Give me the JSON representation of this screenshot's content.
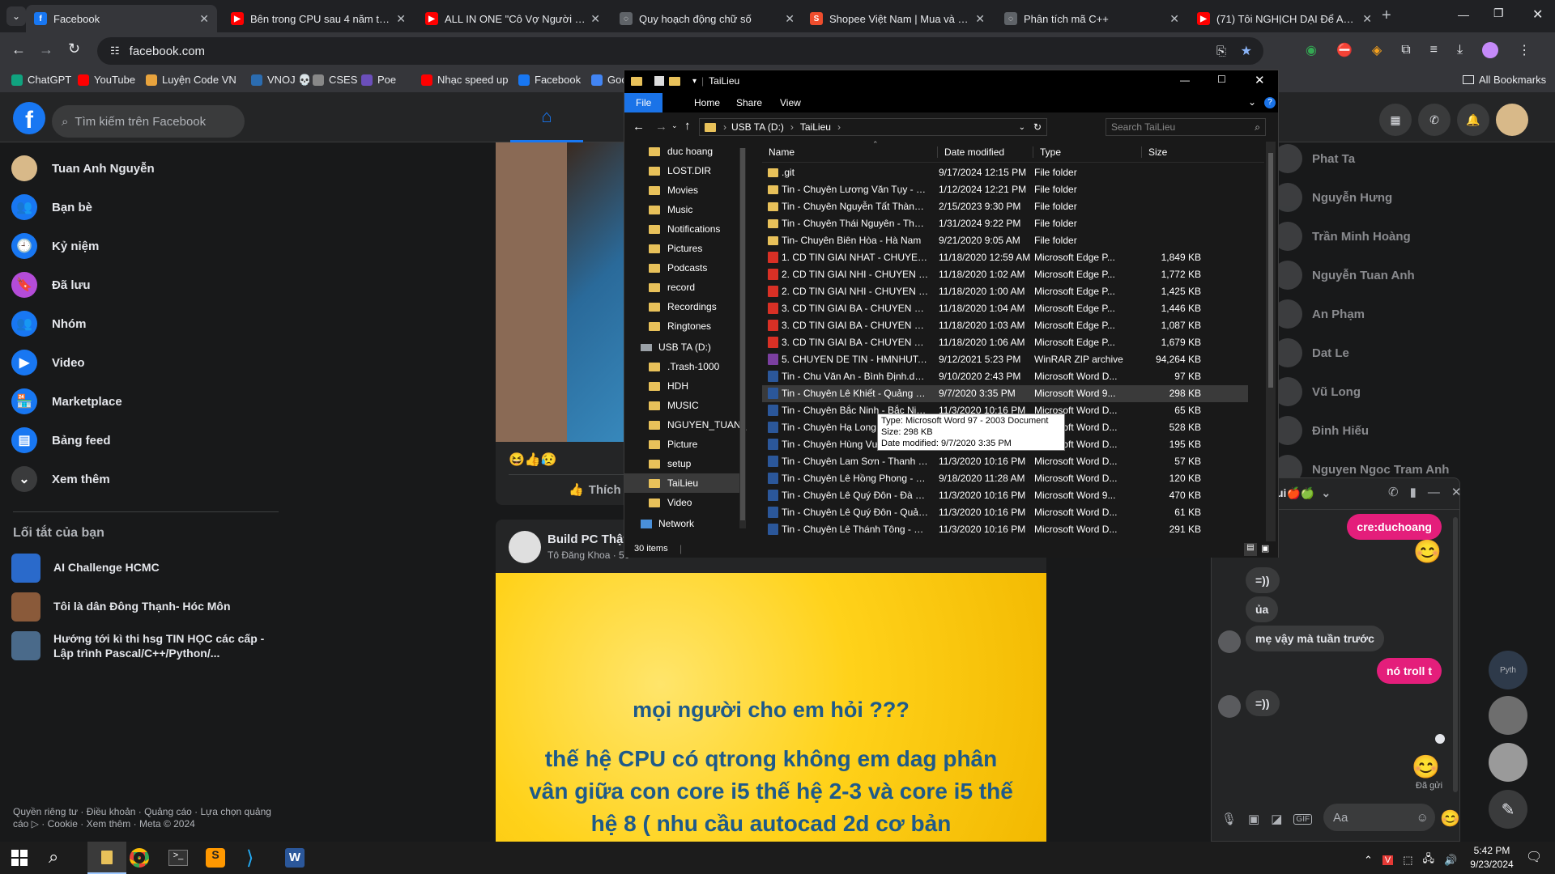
{
  "browser": {
    "tabs": [
      {
        "title": "Facebook",
        "icon": "facebook-icon",
        "color": "#1877f2",
        "active": true
      },
      {
        "title": "Bên trong CPU sau 4 năm thảo",
        "icon": "youtube-icon",
        "color": "#ff0000"
      },
      {
        "title": "ALL IN ONE \"Cô Vợ Người Máy",
        "icon": "youtube-icon",
        "color": "#ff0000"
      },
      {
        "title": "Quy hoạch động chữ số",
        "icon": "globe-icon",
        "color": "#5f6368"
      },
      {
        "title": "Shopee Việt Nam | Mua và Bán",
        "icon": "shopee-icon",
        "color": "#ee4d2d"
      },
      {
        "title": "Phân tích mã C++",
        "icon": "globe-icon",
        "color": "#5f6368"
      },
      {
        "title": "(71) Tôi NGHỊCH DẠI Để Anh E",
        "icon": "youtube-icon",
        "color": "#ff0000"
      }
    ],
    "url": "facebook.com",
    "bookmarks": [
      "ChatGPT",
      "YouTube",
      "Luyện Code VN",
      "VNOJ 💀",
      "CSES",
      "Poe",
      "Nhạc speed up",
      "Facebook",
      "Google"
    ],
    "all_bookmarks": "All Bookmarks"
  },
  "facebook": {
    "search_placeholder": "Tìm kiếm trên Facebook",
    "nav": [
      {
        "label": "Tuan Anh Nguyễn",
        "icon": "profile-avatar"
      },
      {
        "label": "Bạn bè",
        "icon": "friends-icon"
      },
      {
        "label": "Kỷ niệm",
        "icon": "memories-icon"
      },
      {
        "label": "Đã lưu",
        "icon": "saved-icon"
      },
      {
        "label": "Nhóm",
        "icon": "groups-icon"
      },
      {
        "label": "Video",
        "icon": "video-icon"
      },
      {
        "label": "Marketplace",
        "icon": "marketplace-icon"
      },
      {
        "label": "Bảng feed",
        "icon": "feeds-icon"
      },
      {
        "label": "Xem thêm",
        "icon": "chevron-down-icon"
      }
    ],
    "shortcuts_title": "Lối tắt của bạn",
    "shortcuts": [
      "AI Challenge HCMC",
      "Tôi là dân Đông Thạnh- Hóc Môn",
      "Hướng tới kì thi hsg TIN HỌC các cấp - Lập trình Pascal/C++/Python/..."
    ],
    "footer": "Quyền riêng tư · Điều khoản · Quảng cáo · Lựa chọn quảng cáo ▷ · Cookie · Xem thêm · Meta © 2024",
    "like_label": "Thích",
    "post": {
      "page": "Build PC Thật",
      "author": "Tô Đăng Khoa · 50",
      "line1": "mọi người cho em hỏi ???",
      "line2": "thế hệ CPU có qtrong không em dag phân vân giữa con core i5 thế hệ 2-3 và core i5 thế hệ 8 ( nhu cầu autocad 2d cơ bản"
    },
    "contacts": [
      "Phat Ta",
      "Nguyễn Hưng",
      "Trần Minh Hoàng",
      "Nguyễn Tuan Anh",
      "An Phạm",
      "Dat Le",
      "Vũ Long",
      "Đinh Hiếu",
      "Nguyen Ngoc Tram Anh"
    ]
  },
  "chat": {
    "header": "ui🍎🍏",
    "messages": [
      {
        "text": "cre:duchoang",
        "mine": true
      },
      {
        "text": "😊",
        "mine": true,
        "emoji": true
      },
      {
        "text": "=))",
        "mine": false
      },
      {
        "text": "ủa",
        "mine": false
      },
      {
        "text": "mẹ vậy mà tuần trước",
        "mine": false
      },
      {
        "text": "nó troll t",
        "mine": true
      },
      {
        "text": "=))",
        "mine": false
      },
      {
        "text": "😊",
        "mine": true,
        "emoji": true
      }
    ],
    "sent_label": "Đã gửi",
    "input_placeholder": "Aa",
    "side_label": "Pyth"
  },
  "explorer": {
    "title": "TaiLieu",
    "ribbon": [
      "File",
      "Home",
      "Share",
      "View"
    ],
    "path": [
      "USB TA (D:)",
      "TaiLieu"
    ],
    "search_placeholder": "Search TaiLieu",
    "tree": [
      {
        "label": "duc hoang",
        "type": "folder"
      },
      {
        "label": "LOST.DIR",
        "type": "folder"
      },
      {
        "label": "Movies",
        "type": "folder"
      },
      {
        "label": "Music",
        "type": "folder"
      },
      {
        "label": "Notifications",
        "type": "folder"
      },
      {
        "label": "Pictures",
        "type": "folder"
      },
      {
        "label": "Podcasts",
        "type": "folder"
      },
      {
        "label": "record",
        "type": "folder"
      },
      {
        "label": "Recordings",
        "type": "folder"
      },
      {
        "label": "Ringtones",
        "type": "folder"
      },
      {
        "label": "USB TA (D:)",
        "type": "drive"
      },
      {
        "label": ".Trash-1000",
        "type": "folder"
      },
      {
        "label": "HDH",
        "type": "folder"
      },
      {
        "label": "MUSIC",
        "type": "folder"
      },
      {
        "label": "NGUYEN_TUAN_",
        "type": "folder"
      },
      {
        "label": "Picture",
        "type": "folder"
      },
      {
        "label": "setup",
        "type": "folder"
      },
      {
        "label": "TaiLieu",
        "type": "folder",
        "selected": true
      },
      {
        "label": "Video",
        "type": "folder"
      },
      {
        "label": "Network",
        "type": "network"
      }
    ],
    "columns": [
      "Name",
      "Date modified",
      "Type",
      "Size"
    ],
    "files": [
      {
        "name": ".git",
        "date": "9/17/2024 12:15 PM",
        "type": "File folder",
        "size": "",
        "kind": "folder"
      },
      {
        "name": "Tin - Chuyên Lương Văn Tụy - Ninh Bình",
        "date": "1/12/2024 12:21 PM",
        "type": "File folder",
        "size": "",
        "kind": "folder"
      },
      {
        "name": "Tin - Chuyên Nguyễn Tất Thành - Yên Bái",
        "date": "2/15/2023 9:30 PM",
        "type": "File folder",
        "size": "",
        "kind": "folder"
      },
      {
        "name": "Tin - Chuyên Thái Nguyên - Thái Nguyên",
        "date": "1/31/2024 9:22 PM",
        "type": "File folder",
        "size": "",
        "kind": "folder"
      },
      {
        "name": "Tin- Chuyên Biên Hòa - Hà Nam",
        "date": "9/21/2020 9:05 AM",
        "type": "File folder",
        "size": "",
        "kind": "folder"
      },
      {
        "name": "1. CD TIN GIAI NHAT - CHUYEN LAO CAI....",
        "date": "11/18/2020 12:59 AM",
        "type": "Microsoft Edge P...",
        "size": "1,849 KB",
        "kind": "pdf"
      },
      {
        "name": "2. CD TIN GIAI NHI - CHUYEN BIEN HOA ...",
        "date": "11/18/2020 1:02 AM",
        "type": "Microsoft Edge P...",
        "size": "1,772 KB",
        "kind": "pdf"
      },
      {
        "name": "2. CD TIN GIAI NHI - CHUYEN CHU VAN ...",
        "date": "11/18/2020 1:00 AM",
        "type": "Microsoft Edge P...",
        "size": "1,425 KB",
        "kind": "pdf"
      },
      {
        "name": "3. CD TIN GIAI BA - CHUYEN HA LONG - ...",
        "date": "11/18/2020 1:04 AM",
        "type": "Microsoft Edge P...",
        "size": "1,446 KB",
        "kind": "pdf"
      },
      {
        "name": "3. CD TIN GIAI BA - CHUYEN HUNG VUO...",
        "date": "11/18/2020 1:03 AM",
        "type": "Microsoft Edge P...",
        "size": "1,087 KB",
        "kind": "pdf"
      },
      {
        "name": "3. CD TIN GIAI BA - CHUYEN THAI BINH....",
        "date": "11/18/2020 1:06 AM",
        "type": "Microsoft Edge P...",
        "size": "1,679 KB",
        "kind": "pdf"
      },
      {
        "name": "5. CHUYEN DE TIN - HMNHUT.zip",
        "date": "9/12/2021 5:23 PM",
        "type": "WinRAR ZIP archive",
        "size": "94,264 KB",
        "kind": "zip"
      },
      {
        "name": "Tin - Chu Văn An - Bình Định.docx",
        "date": "9/10/2020 2:43 PM",
        "type": "Microsoft Word D...",
        "size": "97 KB",
        "kind": "doc"
      },
      {
        "name": "Tin - Chuyên Lê Khiết - Quảng Ngãi.doc",
        "date": "9/7/2020 3:35 PM",
        "type": "Microsoft Word 9...",
        "size": "298 KB",
        "kind": "doc",
        "selected": true
      },
      {
        "name": "Tin - Chuyên Bắc Ninh - Bắc Ninh.docx",
        "date": "11/3/2020 10:16 PM",
        "type": "Microsoft Word D...",
        "size": "65 KB",
        "kind": "doc"
      },
      {
        "name": "Tin - Chuyên Hạ Long - Quảng Ninh.docx",
        "date": "11/3/2020 10:16 PM",
        "type": "Microsoft Word D...",
        "size": "528 KB",
        "kind": "doc"
      },
      {
        "name": "Tin - Chuyên Hùng Vương - Phú Thọ.docx",
        "date": "11/3/2020 10:16 PM",
        "type": "Microsoft Word D...",
        "size": "195 KB",
        "kind": "doc"
      },
      {
        "name": "Tin - Chuyên Lam Sơn - Thanh Hóa.docx",
        "date": "11/3/2020 10:16 PM",
        "type": "Microsoft Word D...",
        "size": "57 KB",
        "kind": "doc"
      },
      {
        "name": "Tin - Chuyên Lê Hồng Phong - Nam Địn...",
        "date": "9/18/2020 11:28 AM",
        "type": "Microsoft Word D...",
        "size": "120 KB",
        "kind": "doc"
      },
      {
        "name": "Tin - Chuyên Lê Quý Đôn - Đà Nẵng.doc",
        "date": "11/3/2020 10:16 PM",
        "type": "Microsoft Word 9...",
        "size": "470 KB",
        "kind": "doc"
      },
      {
        "name": "Tin - Chuyên Lê Quý Đôn - Quảng Trị.docx",
        "date": "11/3/2020 10:16 PM",
        "type": "Microsoft Word D...",
        "size": "61 KB",
        "kind": "doc"
      },
      {
        "name": "Tin - Chuyên Lê Thánh Tông - Quảng Na...",
        "date": "11/3/2020 10:16 PM",
        "type": "Microsoft Word D...",
        "size": "291 KB",
        "kind": "doc"
      }
    ],
    "tooltip": [
      "Type: Microsoft Word 97 - 2003 Document",
      "Size: 298 KB",
      "Date modified: 9/7/2020 3:35 PM"
    ],
    "status": "30 items"
  },
  "taskbar": {
    "time": "5:42 PM",
    "date": "9/23/2024",
    "apps": [
      "start-icon",
      "search-icon",
      "file-explorer-icon",
      "chrome-icon",
      "terminal-icon",
      "sublime-icon",
      "vscode-icon",
      "word-icon"
    ]
  },
  "colors": {
    "accent": "#1877f2",
    "chat_bubble": "#e41e7b",
    "explorer_select": "#3a3a3a",
    "fb_bg": "#18191a"
  }
}
